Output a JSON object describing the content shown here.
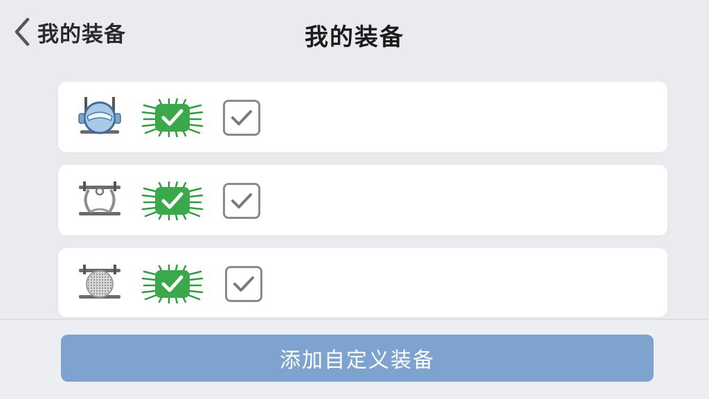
{
  "nav": {
    "back_label": "我的装备",
    "title": "我的装备"
  },
  "equipment": [
    {
      "icon": "helmet-icon",
      "status_icon": "green-check-icon",
      "checked": true
    },
    {
      "icon": "rope-loop-icon",
      "status_icon": "green-check-icon",
      "checked": true
    },
    {
      "icon": "mesh-net-icon",
      "status_icon": "green-check-icon",
      "checked": true
    }
  ],
  "footer": {
    "add_button_label": "添加自定义装备"
  },
  "colors": {
    "background": "#e9ebee",
    "card": "#ffffff",
    "accent_button": "#7ea3cf",
    "status_green": "#39a84a",
    "checkbox_border": "#8a8a8a"
  }
}
